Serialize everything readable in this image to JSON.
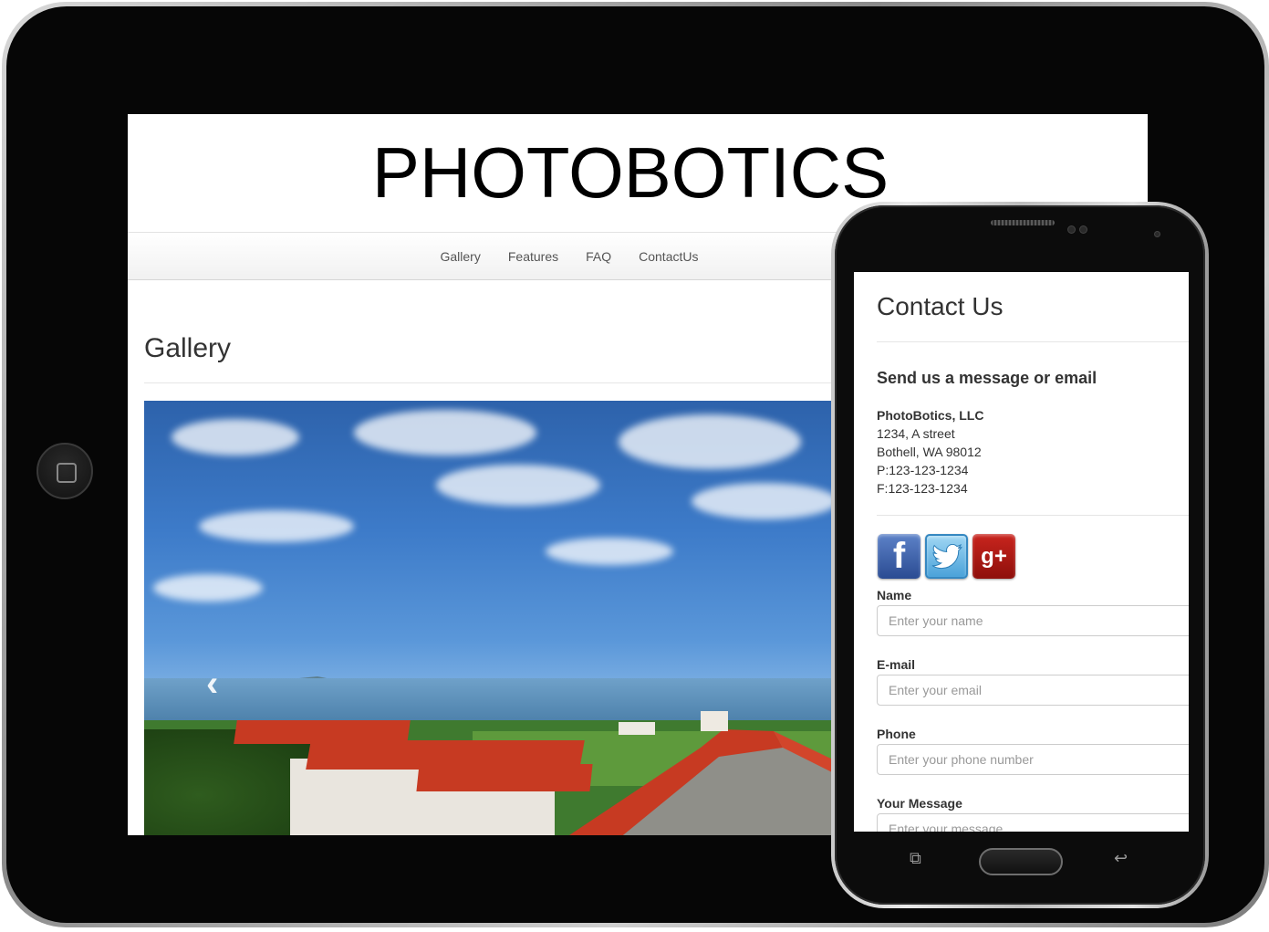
{
  "tablet": {
    "site_title": "PHOTOBOTICS",
    "nav": [
      {
        "label": "Gallery"
      },
      {
        "label": "Features"
      },
      {
        "label": "FAQ"
      },
      {
        "label": "ContactUs"
      }
    ],
    "page_heading": "Gallery",
    "carousel": {
      "prev_icon": "‹"
    }
  },
  "phone": {
    "page_title": "Contact Us",
    "subtitle": "Send us a message or email",
    "address": {
      "company": "PhotoBotics, LLC",
      "street": "1234, A street",
      "city": "Bothell, WA 98012",
      "phone": "P:123-123-1234",
      "fax": "F:123-123-1234"
    },
    "social": {
      "facebook": "f",
      "googleplus": "g+"
    },
    "form": {
      "name_label": "Name",
      "name_placeholder": "Enter your name",
      "email_label": "E-mail",
      "email_placeholder": "Enter your email",
      "phone_label": "Phone",
      "phone_placeholder": "Enter your phone number",
      "message_label": "Your Message",
      "message_placeholder": "Enter your message"
    }
  }
}
